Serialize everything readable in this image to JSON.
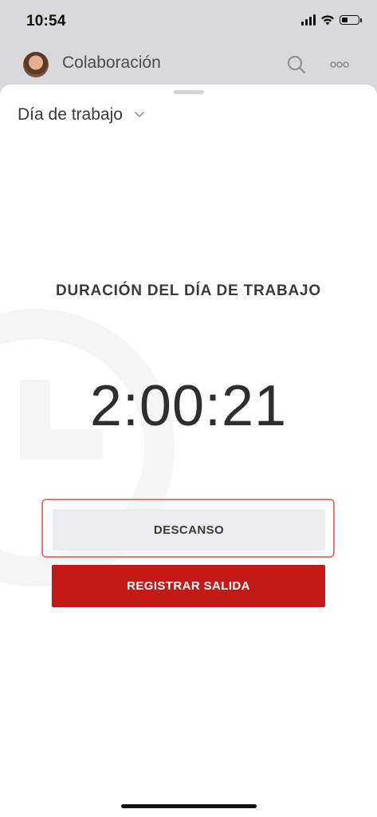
{
  "status_bar": {
    "time": "10:54",
    "icons": [
      "cellular-signal-icon",
      "wifi-icon",
      "battery-icon"
    ],
    "battery_level_percent": 35
  },
  "header": {
    "title": "Colaboración",
    "icons": [
      "avatar",
      "search-icon",
      "more-icon"
    ]
  },
  "sheet": {
    "dropdown_label": "Día de trabajo",
    "section_title": "DURACIÓN DEL DÍA DE TRABAJO",
    "timer": "2:00:21",
    "break_button": "DESCANSO",
    "clock_out_button": "REGISTRAR SALIDA"
  },
  "colors": {
    "accent_red": "#c41a17",
    "highlight_outline": "#e07b7d",
    "secondary_button": "#ececee"
  }
}
